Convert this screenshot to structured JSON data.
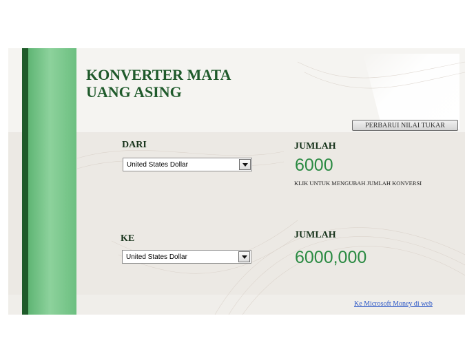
{
  "title": {
    "line1": "KONVERTER MATA",
    "line2": "UANG ASING"
  },
  "refresh_button": "PERBARUI NILAI TUKAR",
  "from": {
    "label": "DARI",
    "currency": "United States Dollar"
  },
  "to": {
    "label": "KE",
    "currency": "United States Dollar"
  },
  "amount_from": {
    "label": "JUMLAH",
    "value": "6000",
    "hint": "KLIK UNTUK MENGUBAH JUMLAH KONVERSI"
  },
  "amount_to": {
    "label": "JUMLAH",
    "value": "6000,000"
  },
  "footer_link": "Ke Microsoft Money di web",
  "colors": {
    "title_green": "#1f5a2b",
    "amount_green": "#2a8a42",
    "stripe_dark": "#1f5b2a",
    "stripe_light": "#8dd29c",
    "link_blue": "#2a56c6"
  }
}
